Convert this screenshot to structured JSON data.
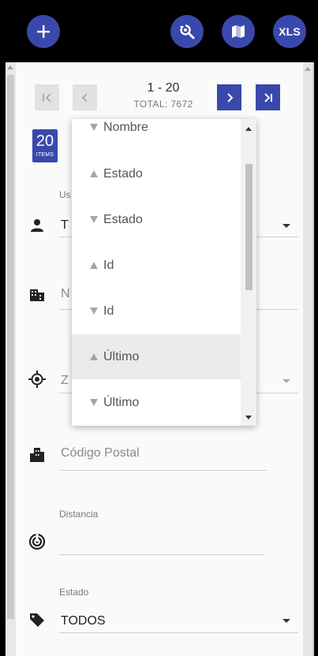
{
  "topbar": {
    "add_icon": "plus-icon",
    "search_icon": "search-refresh-icon",
    "map_icon": "map-icon",
    "xls_label": "XLS",
    "accent_color": "#3949ab"
  },
  "pagination": {
    "range": "1 - 20",
    "total": "TOTAL: 7672",
    "first_label": "|<",
    "prev_label": "<",
    "next_label": ">",
    "last_label": ">|"
  },
  "items_badge": {
    "count": "20",
    "label": "ITEMS"
  },
  "form": {
    "user": {
      "label_partial": "Us",
      "value_partial": "T",
      "icon": "person-icon"
    },
    "name": {
      "placeholder_partial": "N",
      "icon": "building-icon"
    },
    "zone": {
      "placeholder_partial": "Z",
      "icon": "target-icon"
    },
    "postal_code": {
      "placeholder": "Código Postal",
      "icon": "city-icon"
    },
    "distance": {
      "label": "Distancia",
      "icon": "radar-icon"
    },
    "status": {
      "label": "Estado",
      "value": "TODOS",
      "icon": "tag-icon"
    }
  },
  "sort_dropdown": {
    "options": [
      {
        "label": "Nombre",
        "dir": "down"
      },
      {
        "label": "Estado",
        "dir": "up"
      },
      {
        "label": "Estado",
        "dir": "down"
      },
      {
        "label": "Id",
        "dir": "up"
      },
      {
        "label": "Id",
        "dir": "down"
      },
      {
        "label": "Último",
        "dir": "up",
        "highlighted": true
      },
      {
        "label": "Último",
        "dir": "down"
      }
    ]
  }
}
